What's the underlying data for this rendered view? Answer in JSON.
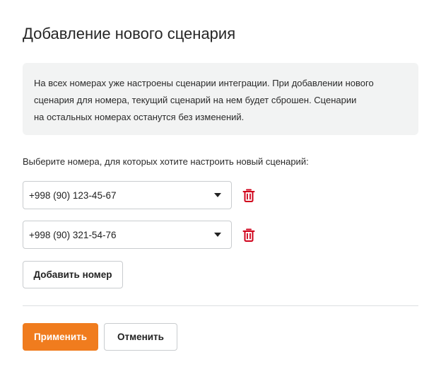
{
  "dialog": {
    "title": "Добавление нового сценария",
    "notice_lines": [
      "На всех номерах уже настроены сценарии интеграции. При добавлении нового",
      "сценария для номера, текущий сценарий на нем будет сброшен. Сценарии",
      "на остальных номерах останутся без изменений."
    ],
    "select_label": "Выберите номера, для которых хотите настроить новый сценарий:",
    "numbers": [
      {
        "value": "+998 (90) 123-45-67",
        "icon": "trash-icon"
      },
      {
        "value": "+998 (90) 321-54-76",
        "icon": "trash-icon"
      }
    ],
    "add_number_label": "Добавить номер",
    "apply_label": "Применить",
    "cancel_label": "Отменить"
  },
  "colors": {
    "accent": "#f07c1e",
    "danger": "#d0021b",
    "notice_bg": "#f2f3f3",
    "border": "#c9cccf"
  }
}
